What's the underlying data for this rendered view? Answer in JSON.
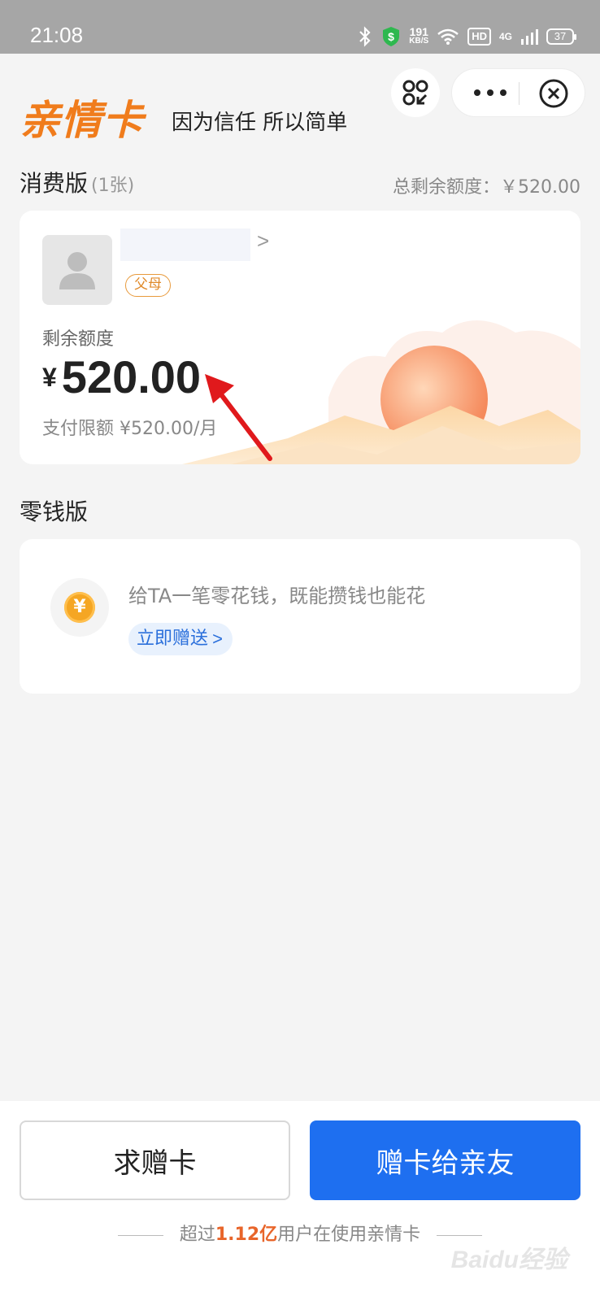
{
  "status_bar": {
    "time": "21:08",
    "net_speed": "191",
    "net_speed_unit": "KB/S",
    "hd": "HD",
    "network": "4G",
    "battery": "37"
  },
  "header": {
    "logo": "亲情卡",
    "slogan": "因为信任 所以简单"
  },
  "consumption": {
    "title": "消费版",
    "count": "(1张)",
    "total_label": "总剩余额度：￥520.00",
    "card": {
      "relation_tag": "父母",
      "name_chevron": ">",
      "remaining_label": "剩余额度",
      "currency": "¥",
      "amount": "520.00",
      "limit": "支付限额 ¥520.00/月"
    }
  },
  "pocket_money": {
    "title": "零钱版",
    "coin_symbol": "¥",
    "description": "给TA一笔零花钱，既能攒钱也能花",
    "button": "立即赠送",
    "button_chevron": ">"
  },
  "bottom": {
    "ask_button": "求赠卡",
    "give_button": "赠卡给亲友",
    "note_prefix": "超过",
    "note_highlight": "1.12亿",
    "note_suffix": "用户在使用亲情卡"
  },
  "watermark": "Baidu经验",
  "colors": {
    "brand_orange": "#f07c1c",
    "primary_blue": "#1e6ff0",
    "tag_orange": "#e08a2a",
    "arrow_red": "#e0191c"
  },
  "icons": [
    "bluetooth-icon",
    "shield-icon",
    "wifi-icon",
    "signal-icon",
    "battery-icon",
    "scan-icon",
    "more-icon",
    "close-icon",
    "avatar-icon",
    "coin-icon",
    "annotation-arrow"
  ]
}
